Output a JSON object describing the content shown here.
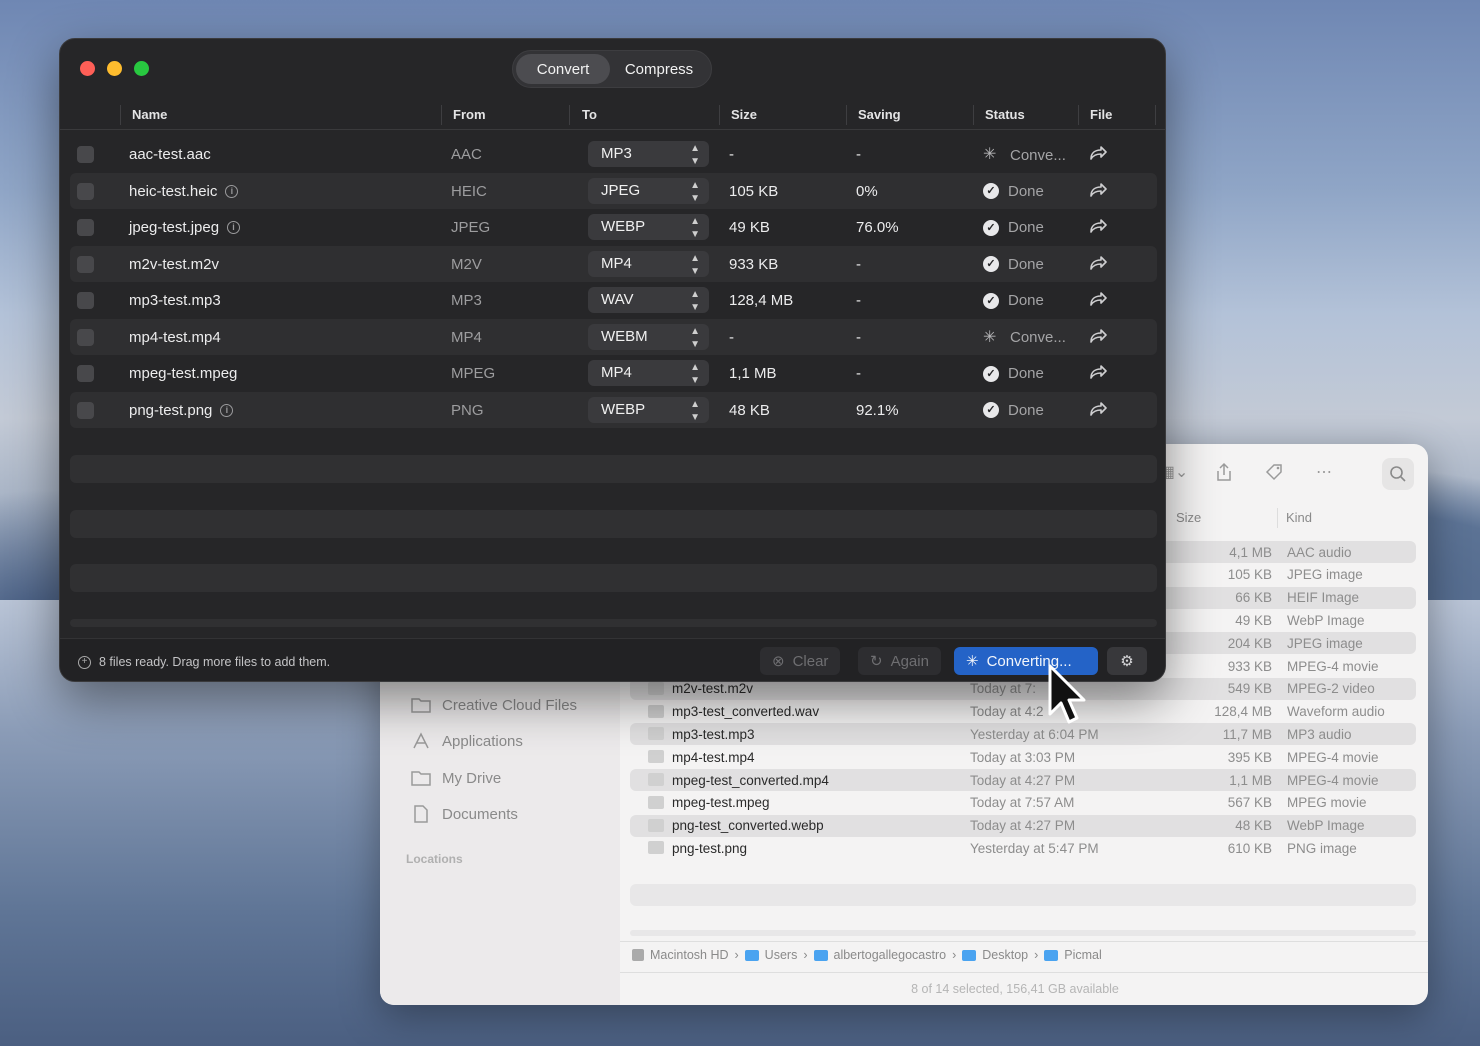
{
  "app": {
    "tabs": [
      {
        "label": "Convert",
        "active": true
      },
      {
        "label": "Compress",
        "active": false
      }
    ],
    "columns": [
      "Name",
      "From",
      "To",
      "Size",
      "Saving",
      "Status",
      "File"
    ],
    "rows": [
      {
        "name": "aac-test.aac",
        "info": false,
        "from": "AAC",
        "to": "MP3",
        "size": "-",
        "saving": "-",
        "status": "Conve...",
        "state": "converting"
      },
      {
        "name": "heic-test.heic",
        "info": true,
        "from": "HEIC",
        "to": "JPEG",
        "size": "105 KB",
        "saving": "0%",
        "status": "Done",
        "state": "done"
      },
      {
        "name": "jpeg-test.jpeg",
        "info": true,
        "from": "JPEG",
        "to": "WEBP",
        "size": "49 KB",
        "saving": "76.0%",
        "status": "Done",
        "state": "done"
      },
      {
        "name": "m2v-test.m2v",
        "info": false,
        "from": "M2V",
        "to": "MP4",
        "size": "933 KB",
        "saving": "-",
        "status": "Done",
        "state": "done"
      },
      {
        "name": "mp3-test.mp3",
        "info": false,
        "from": "MP3",
        "to": "WAV",
        "size": "128,4 MB",
        "saving": "-",
        "status": "Done",
        "state": "done"
      },
      {
        "name": "mp4-test.mp4",
        "info": false,
        "from": "MP4",
        "to": "WEBM",
        "size": "-",
        "saving": "-",
        "status": "Conve...",
        "state": "converting"
      },
      {
        "name": "mpeg-test.mpeg",
        "info": false,
        "from": "MPEG",
        "to": "MP4",
        "size": "1,1 MB",
        "saving": "-",
        "status": "Done",
        "state": "done"
      },
      {
        "name": "png-test.png",
        "info": true,
        "from": "PNG",
        "to": "WEBP",
        "size": "48 KB",
        "saving": "92.1%",
        "status": "Done",
        "state": "done"
      }
    ],
    "footer": {
      "status_text": "8 files ready. Drag more files to add them.",
      "clear_label": "Clear",
      "again_label": "Again",
      "converting_label": "Converting..."
    }
  },
  "finder": {
    "header_size": "Size",
    "header_kind": "Kind",
    "sidebar": [
      "Creative Cloud Files",
      "Applications",
      "My Drive",
      "Documents"
    ],
    "sidebar_section": "Locations",
    "files": [
      {
        "name": "",
        "date": "",
        "size": "4,1 MB",
        "kind": "AAC audio"
      },
      {
        "name": "",
        "date": "",
        "size": "105 KB",
        "kind": "JPEG image"
      },
      {
        "name": "",
        "date": "",
        "size": "66 KB",
        "kind": "HEIF Image"
      },
      {
        "name": "",
        "date": "",
        "size": "49 KB",
        "kind": "WebP Image"
      },
      {
        "name": "",
        "date": "",
        "size": "204 KB",
        "kind": "JPEG image"
      },
      {
        "name": "",
        "date": "",
        "size": "933 KB",
        "kind": "MPEG-4 movie"
      },
      {
        "name": "m2v-test.m2v",
        "date": "Today at 7:",
        "size": "549 KB",
        "kind": "MPEG-2 video"
      },
      {
        "name": "mp3-test_converted.wav",
        "date": "Today at 4:2",
        "size": "128,4 MB",
        "kind": "Waveform audio"
      },
      {
        "name": "mp3-test.mp3",
        "date": "Yesterday at 6:04 PM",
        "size": "11,7 MB",
        "kind": "MP3 audio"
      },
      {
        "name": "mp4-test.mp4",
        "date": "Today at 3:03 PM",
        "size": "395 KB",
        "kind": "MPEG-4 movie"
      },
      {
        "name": "mpeg-test_converted.mp4",
        "date": "Today at 4:27 PM",
        "size": "1,1 MB",
        "kind": "MPEG-4 movie"
      },
      {
        "name": "mpeg-test.mpeg",
        "date": "Today at 7:57 AM",
        "size": "567 KB",
        "kind": "MPEG movie"
      },
      {
        "name": "png-test_converted.webp",
        "date": "Today at 4:27 PM",
        "size": "48 KB",
        "kind": "WebP Image"
      },
      {
        "name": "png-test.png",
        "date": "Yesterday at 5:47 PM",
        "size": "610 KB",
        "kind": "PNG image"
      }
    ],
    "path": [
      "Macintosh HD",
      "Users",
      "albertogallegocastro",
      "Desktop",
      "Picmal"
    ],
    "status": "8 of 14 selected, 156,41 GB available"
  }
}
